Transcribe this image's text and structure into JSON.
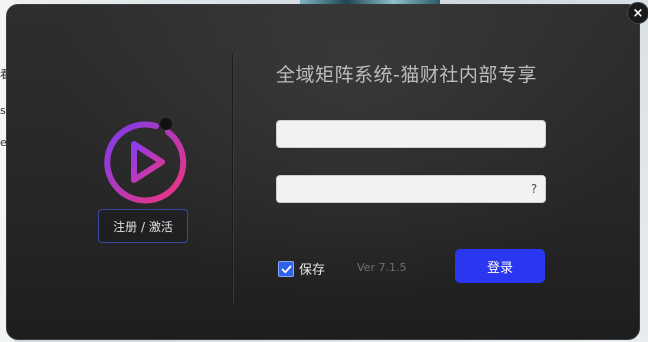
{
  "window": {
    "title": "全域矩阵系统-猫财社内部专享",
    "close_label": "×"
  },
  "logo": {
    "icon": "play-circle-icon",
    "colors": {
      "ring_start": "#7b3cf0",
      "ring_end": "#f0357a",
      "dot": "#111111"
    }
  },
  "left_panel": {
    "register_label": "注册 / 激活"
  },
  "form": {
    "username_value": "",
    "password_value": "",
    "help_label": "?",
    "remember_label": "保存",
    "remember_checked": true,
    "version": "Ver 7.1.5",
    "login_label": "登录"
  },
  "background_text": [
    "看",
    "s",
    "e"
  ],
  "colors": {
    "accent": "#2a36f0",
    "window_bg": "#262626",
    "checkbox": "#2f63e8",
    "register_border": "#3b49a6"
  }
}
